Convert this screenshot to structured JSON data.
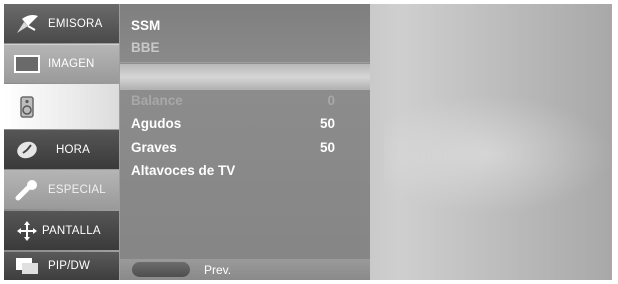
{
  "sidebar": {
    "tabs": [
      {
        "label": "EMISORA",
        "icon": "antenna-icon"
      },
      {
        "label": "IMAGEN",
        "icon": "picture-icon"
      },
      {
        "label": "",
        "icon": "speaker-icon"
      },
      {
        "label": "HORA",
        "icon": "clock-icon"
      },
      {
        "label": "ESPECIAL",
        "icon": "key-icon"
      },
      {
        "label": "PANTALLA",
        "icon": "cross-arrows-icon"
      },
      {
        "label": "PIP/DW",
        "icon": "pip-icon"
      }
    ]
  },
  "menu": {
    "ssm": "SSM",
    "bbe": "BBE",
    "balance": {
      "label": "Balance",
      "value": "0"
    },
    "agudos": {
      "label": "Agudos",
      "value": "50"
    },
    "graves": {
      "label": "Graves",
      "value": "50"
    },
    "altavoces": "Altavoces de TV"
  },
  "footer": {
    "prev_label": "Prev."
  }
}
